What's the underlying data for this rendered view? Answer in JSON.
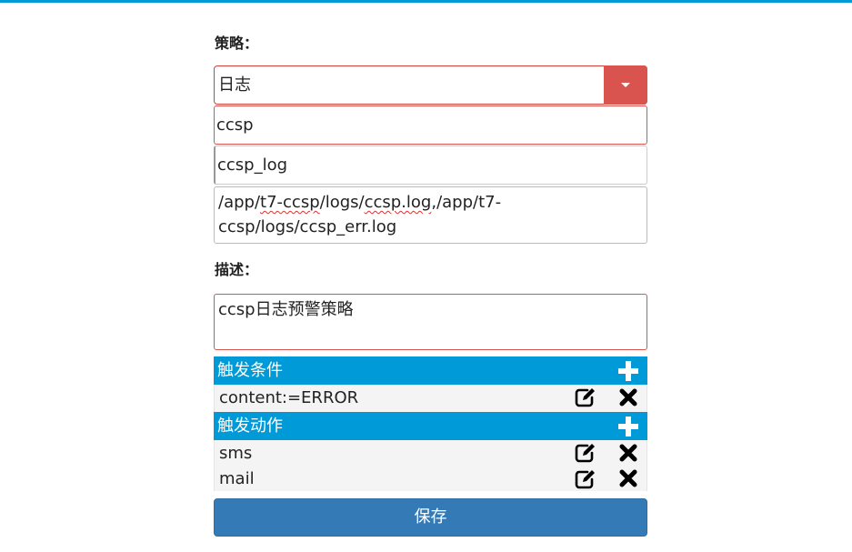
{
  "form": {
    "strategy_label": "策略：",
    "strategy_select_value": "日志",
    "name_value": "ccsp",
    "log_name_value": "ccsp_log",
    "log_paths": {
      "line1_a": "/app/",
      "line1_b": "t7-ccsp",
      "line1_c": "/logs/",
      "line1_d": "ccsp.log",
      "line1_e": ",/app/t7-",
      "line2": "ccsp/logs/ccsp_err.log"
    },
    "description_label": "描述：",
    "description_value": "ccsp日志预警策略"
  },
  "conditions": {
    "header": "触发条件",
    "items": [
      {
        "label": "content:=ERROR"
      }
    ]
  },
  "actions": {
    "header": "触发动作",
    "items": [
      {
        "label": "sms"
      },
      {
        "label": "mail"
      }
    ]
  },
  "save_label": "保存",
  "icons": {
    "dropdown": "caret-down-icon",
    "add": "plus-icon",
    "edit": "edit-icon",
    "delete": "close-icon"
  },
  "colors": {
    "accent": "#009ad8",
    "danger": "#d9534f",
    "primary": "#337ab7"
  }
}
